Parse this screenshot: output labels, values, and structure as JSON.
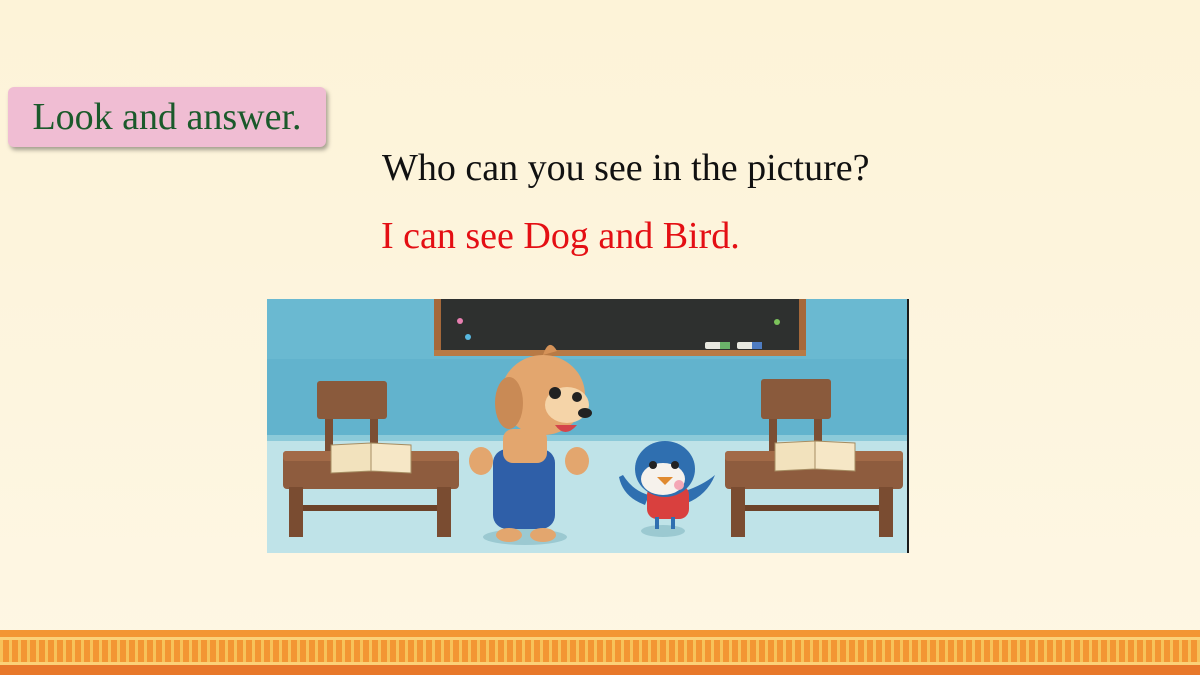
{
  "tag": {
    "label": "Look and answer."
  },
  "question": "Who can you see in the picture?",
  "answer": "I can see Dog and Bird.",
  "colors": {
    "tag_bg": "#f0bdd3",
    "tag_text": "#1b5a2b",
    "answer_text": "#e40f14",
    "question_text": "#111111",
    "border": "#f39633"
  }
}
